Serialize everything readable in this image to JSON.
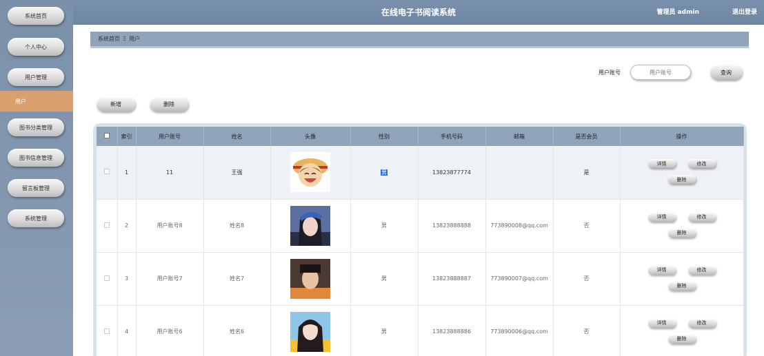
{
  "sidebar": {
    "items": [
      "系统首页",
      "个人中心",
      "用户管理",
      "用户",
      "图书分类管理",
      "图书信息管理",
      "留言板管理",
      "系统管理"
    ]
  },
  "header": {
    "title": "在线电子书阅读系统",
    "user": "管理员 admin",
    "logout": "退出登录"
  },
  "breadcrumb": {
    "home": "系统首页",
    "separator": "Ξ",
    "current": "用户"
  },
  "search": {
    "label": "用户账号",
    "placeholder": "用户账号",
    "button": "查询"
  },
  "actions": {
    "add": "新增",
    "delete": "删除"
  },
  "table": {
    "columns": [
      "",
      "索引",
      "用户账号",
      "姓名",
      "头像",
      "性别",
      "手机号码",
      "邮箱",
      "是否会员",
      "操作"
    ],
    "rows": [
      {
        "index": "1",
        "account": "11",
        "name": "王强",
        "gender": "男",
        "phone": "13823877774",
        "email": "",
        "member": "是"
      },
      {
        "index": "2",
        "account": "用户账号8",
        "name": "姓名8",
        "gender": "男",
        "phone": "13823888888",
        "email": "773890008@qq.com",
        "member": "否"
      },
      {
        "index": "3",
        "account": "用户账号7",
        "name": "姓名7",
        "gender": "男",
        "phone": "13823888887",
        "email": "773890007@qq.com",
        "member": "否"
      },
      {
        "index": "4",
        "account": "用户账号6",
        "name": "姓名6",
        "gender": "男",
        "phone": "13823888886",
        "email": "773890006@qq.com",
        "member": "否"
      }
    ],
    "row_ops": {
      "detail": "详情",
      "edit": "修改",
      "delete": "删除"
    }
  },
  "colors": {
    "sidebar": "#7b91aa",
    "header": "#7890ab",
    "active": "#d9a06e",
    "table_header": "#8fa3b9"
  }
}
